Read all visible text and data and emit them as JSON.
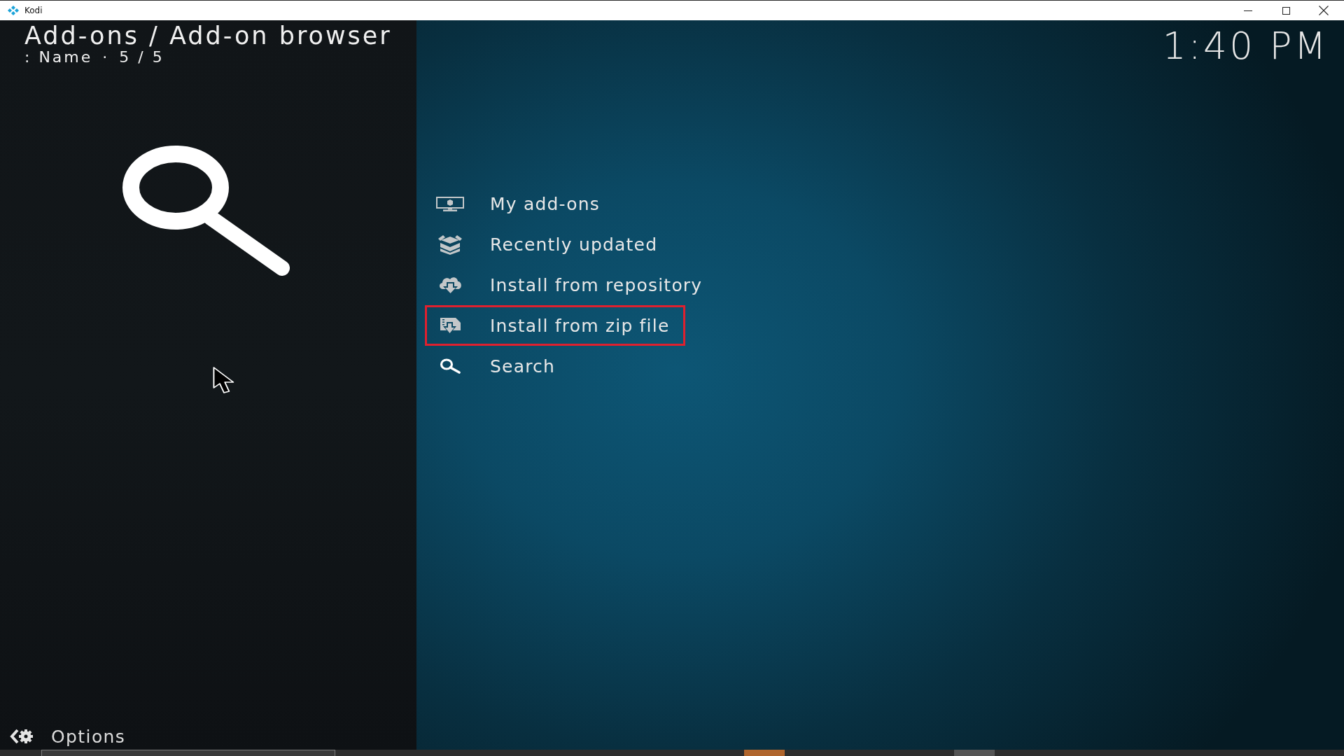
{
  "window": {
    "title": "Kodi"
  },
  "header": {
    "title": "Add-ons / Add-on browser",
    "sort": ": Name",
    "separator": "·",
    "count": "5 / 5"
  },
  "clock": "1:40 PM",
  "menu": {
    "items": [
      {
        "label": "My add-ons",
        "highlighted": false
      },
      {
        "label": "Recently updated",
        "highlighted": false
      },
      {
        "label": "Install from repository",
        "highlighted": false
      },
      {
        "label": "Install from zip file",
        "highlighted": true
      },
      {
        "label": "Search",
        "highlighted": false
      }
    ]
  },
  "options": {
    "label": "Options"
  }
}
